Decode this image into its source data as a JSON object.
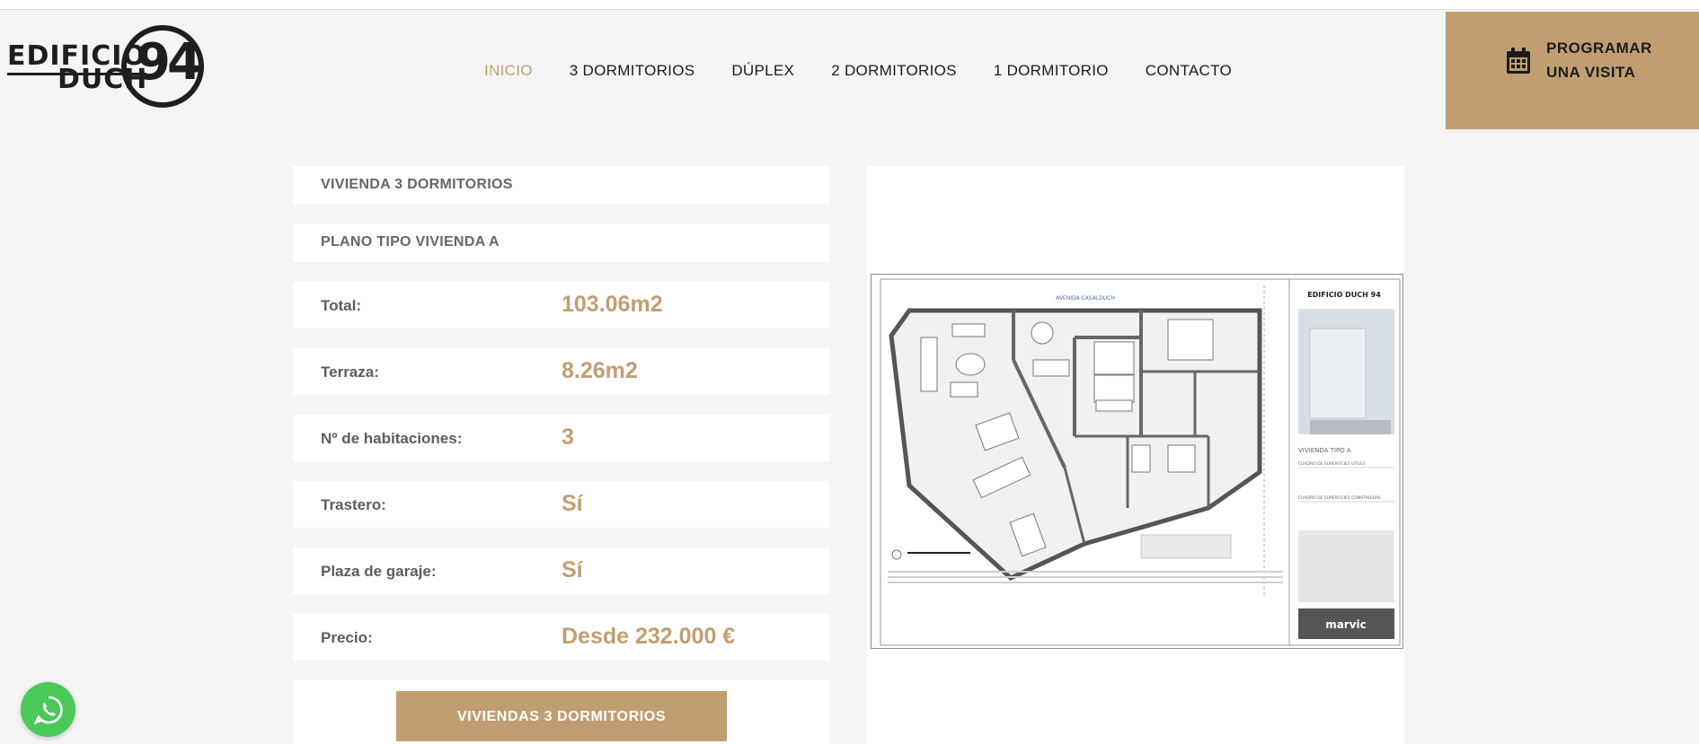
{
  "logo": {
    "word1": "EDIFICIO",
    "word2": "DUCH",
    "number": "94"
  },
  "nav": {
    "items": [
      {
        "label": "INICIO",
        "active": true
      },
      {
        "label": "3 DORMITORIOS",
        "active": false
      },
      {
        "label": "DÚPLEX",
        "active": false
      },
      {
        "label": "2 DORMITORIOS",
        "active": false
      },
      {
        "label": "1 DORMITORIO",
        "active": false
      },
      {
        "label": "CONTACTO",
        "active": false
      }
    ]
  },
  "cta": {
    "line1": "PROGRAMAR",
    "line2": "UNA VISITA",
    "icon": "calendar-icon"
  },
  "property": {
    "heading": "VIVIENDA 3 DORMITORIOS",
    "plan_title": "PLANO TIPO VIVIENDA A",
    "rows": [
      {
        "label": "Total:",
        "value": "103.06m2"
      },
      {
        "label": "Terraza:",
        "value": "8.26m2"
      },
      {
        "label": "Nº de habitaciones:",
        "value": "3"
      },
      {
        "label": "Trastero:",
        "value": "Sí"
      },
      {
        "label": "Plaza de garaje:",
        "value": "Sí"
      },
      {
        "label": "Precio:",
        "value": "Desde 232.000 €"
      }
    ],
    "button_label": "VIVIENDAS 3 DORMITORIOS"
  },
  "floorplan": {
    "street_label": "AVENIDA CASALDUCH",
    "brand": "EDIFICIO DUCH 94",
    "type_label": "VIVIENDA TIPO A",
    "table1_title": "CUADRO DE SUPERFICIES ÚTILES",
    "table2_title": "CUADRO DE SUPERFICIES CONSTRUIDAS",
    "agency": "marvic"
  },
  "colors": {
    "accent": "#c19e71",
    "text": "#1b1b1b",
    "whatsapp": "#4ac959"
  },
  "whatsapp": {
    "icon": "whatsapp-icon"
  }
}
